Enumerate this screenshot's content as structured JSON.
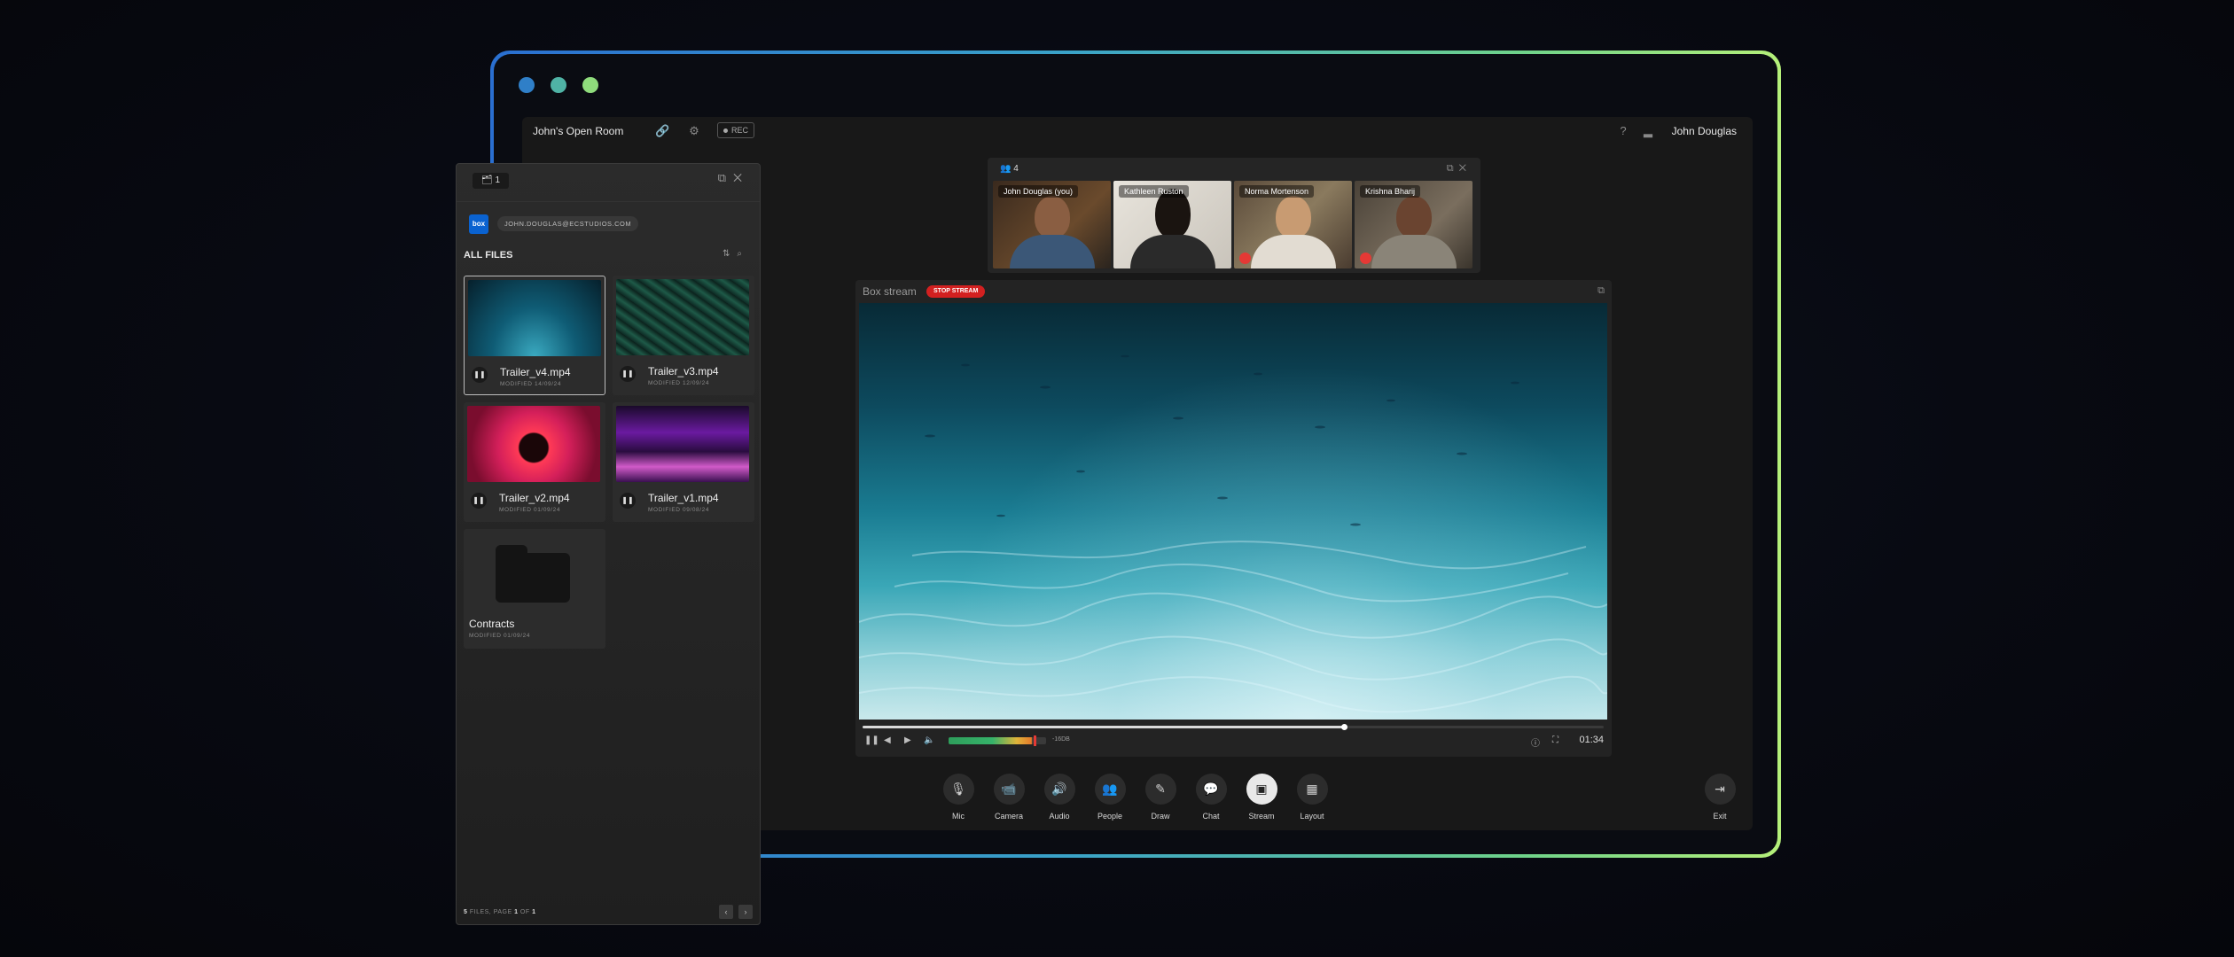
{
  "room": {
    "title": "John's Open Room",
    "rec_label": "REC",
    "user_name": "John Douglas"
  },
  "participants": {
    "count": "4",
    "people": [
      {
        "name": "John Douglas (you)",
        "muted": false
      },
      {
        "name": "Kathleen Ruston",
        "muted": false
      },
      {
        "name": "Norma Mortenson",
        "muted": true
      },
      {
        "name": "Krishna Bharij",
        "muted": true
      }
    ]
  },
  "stream": {
    "title": "Box stream",
    "stop_label": "STOP STREAM",
    "db_label": "-16DB",
    "time": "01:34",
    "progress": 0.65,
    "volume_level": 0.85
  },
  "toolbar": {
    "mic": "Mic",
    "camera": "Camera",
    "audio": "Audio",
    "people": "People",
    "draw": "Draw",
    "chat": "Chat",
    "stream": "Stream",
    "layout": "Layout",
    "exit": "Exit"
  },
  "files_panel": {
    "badge_count": "1",
    "email": "JOHN.DOUGLAS@ECSTUDIOS.COM",
    "heading": "ALL FILES",
    "files": [
      {
        "name": "Trailer_v4.mp4",
        "modified": "MODIFIED 14/09/24",
        "selected": true
      },
      {
        "name": "Trailer_v3.mp4",
        "modified": "MODIFIED 12/09/24",
        "selected": false
      },
      {
        "name": "Trailer_v2.mp4",
        "modified": "MODIFIED 01/09/24",
        "selected": false
      },
      {
        "name": "Trailer_v1.mp4",
        "modified": "MODIFIED 09/08/24",
        "selected": false
      },
      {
        "name": "Contracts",
        "modified": "MODIFIED 01/09/24",
        "selected": false
      }
    ],
    "footer_count": "5",
    "footer_files": " FILES, PAGE ",
    "footer_page": "1",
    "footer_of": " OF ",
    "footer_total": "1"
  },
  "colors": {
    "stop_red": "#d32020",
    "box_blue": "#0a62d0",
    "frame_start": "#2a6fd0",
    "frame_end": "#b5f07a"
  }
}
